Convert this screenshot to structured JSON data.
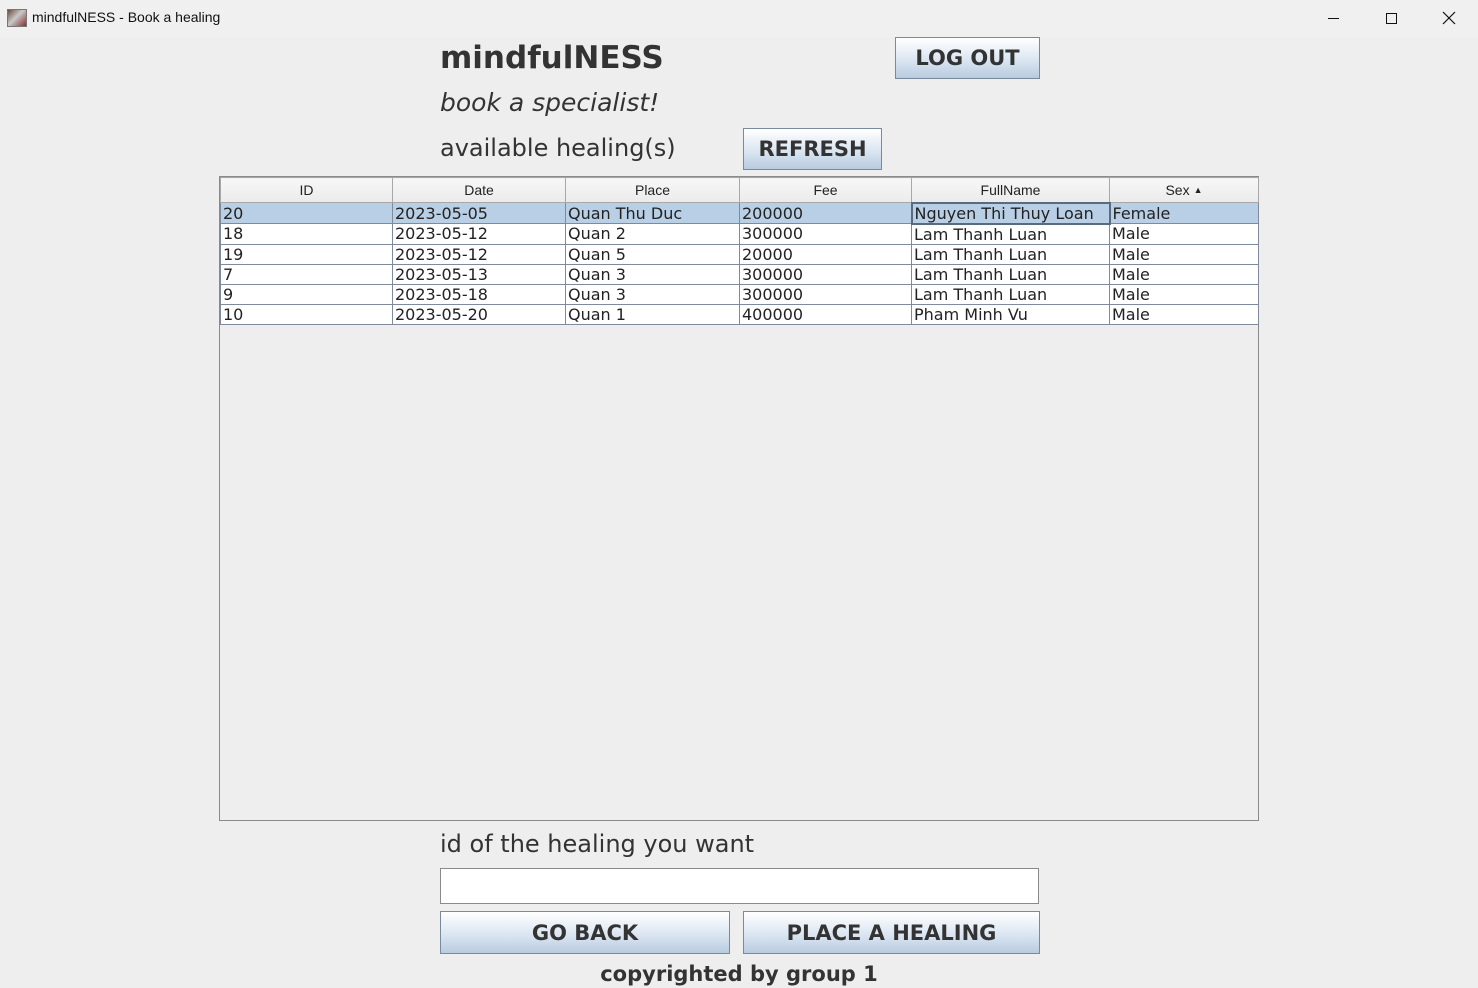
{
  "window": {
    "title": "mindfulNESS - Book a healing"
  },
  "header": {
    "brand": "mindfulNESS",
    "tagline": "book a specialist!",
    "section_label": "available healing(s)",
    "logout_label": "LOG OUT",
    "refresh_label": "REFRESH"
  },
  "table": {
    "columns": [
      "ID",
      "Date",
      "Place",
      "Fee",
      "FullName",
      "Sex"
    ],
    "sorted_column": "Sex",
    "sort_direction": "ascending",
    "selected_row": 0,
    "rows": [
      [
        "20",
        "2023-05-05",
        "Quan Thu Duc",
        "200000",
        "Nguyen Thi Thuy Loan",
        "Female"
      ],
      [
        "18",
        "2023-05-12",
        "Quan 2",
        "300000",
        "Lam Thanh Luan",
        "Male"
      ],
      [
        "19",
        "2023-05-12",
        "Quan 5",
        "20000",
        "Lam Thanh Luan",
        "Male"
      ],
      [
        "7",
        "2023-05-13",
        "Quan 3",
        "300000",
        "Lam Thanh Luan",
        "Male"
      ],
      [
        "9",
        "2023-05-18",
        "Quan 3",
        "300000",
        "Lam Thanh Luan",
        "Male"
      ],
      [
        "10",
        "2023-05-20",
        "Quan 1",
        "400000",
        "Pham Minh Vu",
        "Male"
      ]
    ]
  },
  "form": {
    "id_label": "id of the healing you want",
    "id_value": "",
    "go_back_label": "GO BACK",
    "place_label": "PLACE A HEALING"
  },
  "footer": {
    "text": "copyrighted by group 1"
  }
}
